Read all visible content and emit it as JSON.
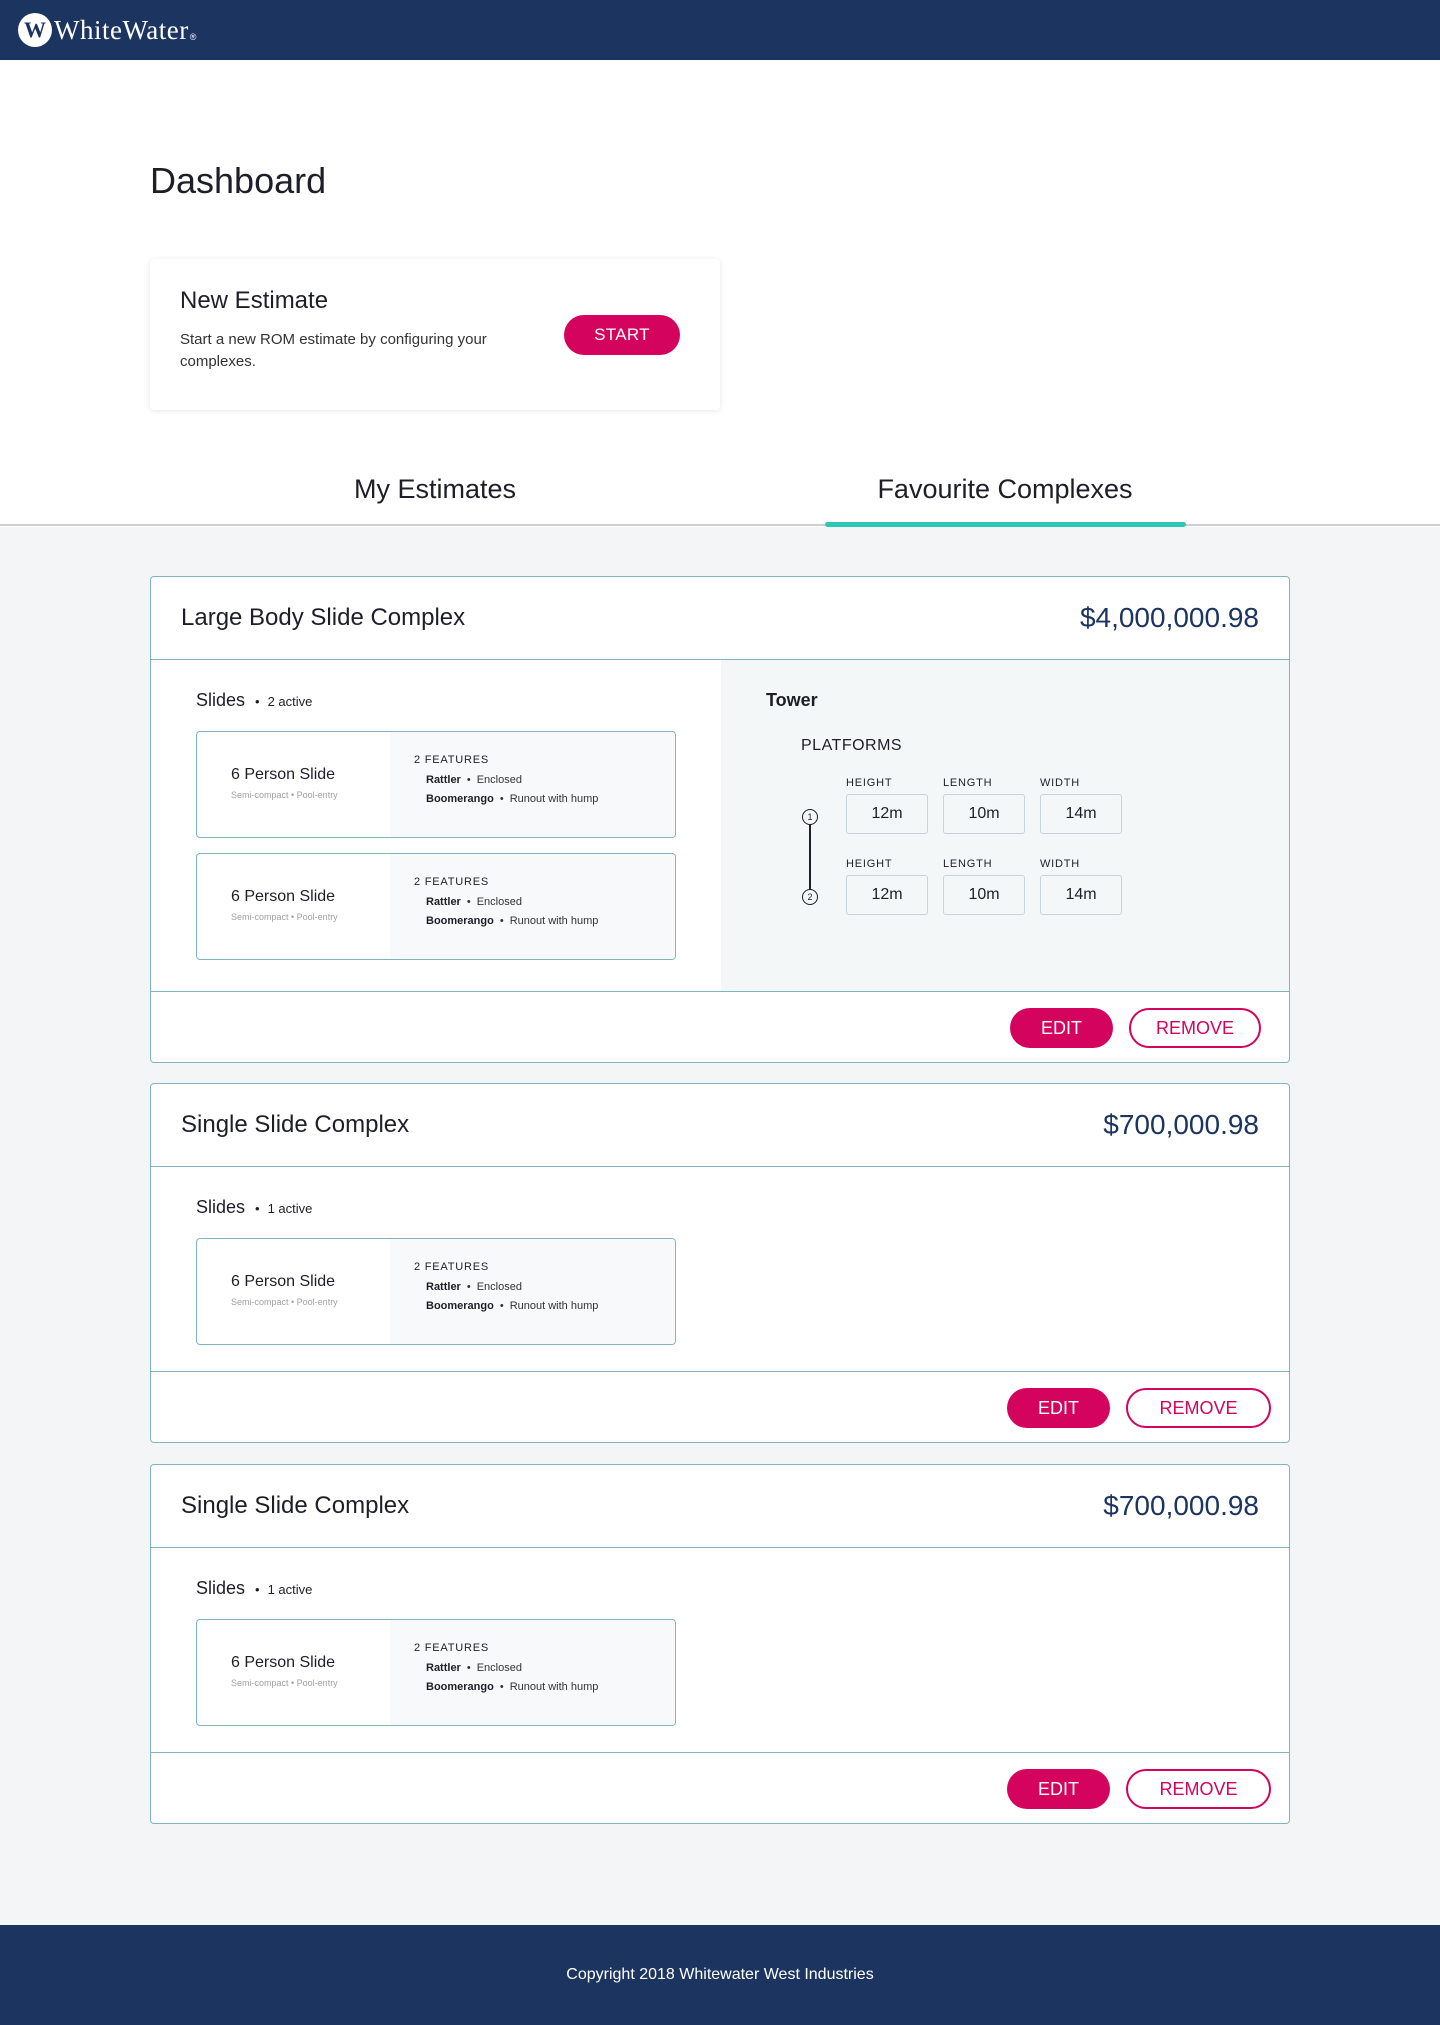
{
  "brand": {
    "name": "WhiteWater",
    "reg": "®"
  },
  "page": {
    "title": "Dashboard"
  },
  "new_estimate": {
    "title": "New Estimate",
    "description": "Start a new ROM estimate by configuring your complexes.",
    "start_label": "START"
  },
  "tabs": [
    {
      "label": "My Estimates",
      "active": false
    },
    {
      "label": "Favourite Complexes",
      "active": true
    }
  ],
  "complexes": [
    {
      "title": "Large Body Slide Complex",
      "price": "$4,000,000.98",
      "slides_label": "Slides",
      "active_count": "2 active",
      "slides": [
        {
          "name": "6 Person Slide",
          "sub": "Semi-compact  •  Pool-entry",
          "features_title": "2 FEATURES",
          "features": [
            {
              "name": "Rattler",
              "desc": "Enclosed"
            },
            {
              "name": "Boomerango",
              "desc": "Runout with hump"
            }
          ]
        },
        {
          "name": "6 Person Slide",
          "sub": "Semi-compact  •  Pool-entry",
          "features_title": "2 FEATURES",
          "features": [
            {
              "name": "Rattler",
              "desc": "Enclosed"
            },
            {
              "name": "Boomerango",
              "desc": "Runout with hump"
            }
          ]
        }
      ],
      "tower": {
        "title": "Tower",
        "platforms_title": "PLATFORMS",
        "platforms": [
          {
            "number": "1",
            "height_label": "HEIGHT",
            "height": "12m",
            "length_label": "LENGTH",
            "length": "10m",
            "width_label": "WIDTH",
            "width": "14m"
          },
          {
            "number": "2",
            "height_label": "HEIGHT",
            "height": "12m",
            "length_label": "LENGTH",
            "length": "10m",
            "width_label": "WIDTH",
            "width": "14m"
          }
        ]
      },
      "edit_label": "EDIT",
      "remove_label": "REMOVE"
    },
    {
      "title": "Single Slide Complex",
      "price": "$700,000.98",
      "slides_label": "Slides",
      "active_count": "1 active",
      "slides": [
        {
          "name": "6 Person Slide",
          "sub": "Semi-compact  •  Pool-entry",
          "features_title": "2 FEATURES",
          "features": [
            {
              "name": "Rattler",
              "desc": "Enclosed"
            },
            {
              "name": "Boomerango",
              "desc": "Runout with hump"
            }
          ]
        }
      ],
      "edit_label": "EDIT",
      "remove_label": "REMOVE"
    },
    {
      "title": "Single Slide Complex",
      "price": "$700,000.98",
      "slides_label": "Slides",
      "active_count": "1 active",
      "slides": [
        {
          "name": "6 Person Slide",
          "sub": "Semi-compact  •  Pool-entry",
          "features_title": "2 FEATURES",
          "features": [
            {
              "name": "Rattler",
              "desc": "Enclosed"
            },
            {
              "name": "Boomerango",
              "desc": "Runout with hump"
            }
          ]
        }
      ],
      "edit_label": "EDIT",
      "remove_label": "REMOVE"
    }
  ],
  "footer": {
    "copyright": "Copyright 2018 Whitewater West Industries"
  },
  "colors": {
    "navy": "#1c3460",
    "accent_pink": "#d4035d",
    "tab_teal": "#2ec7b4",
    "card_border": "#7fb5c2"
  }
}
